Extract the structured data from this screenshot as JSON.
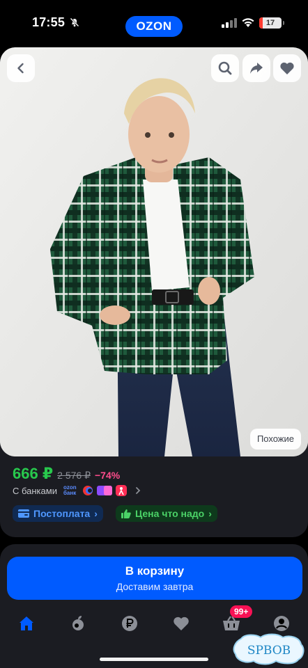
{
  "status_bar": {
    "time": "17:55",
    "brand": "OZON",
    "battery_level": "17",
    "battery_fraction": 0.17
  },
  "product": {
    "similar_label": "Похожие",
    "price": "666 ₽",
    "old_price": "2 576 ₽",
    "discount": "−74%",
    "banks_label": "С банками",
    "bank_ozon_line1": "ozon",
    "bank_ozon_line2": "банк",
    "postpay_label": "Постоплата",
    "fair_price_label": "Цена что надо"
  },
  "action": {
    "cart_title": "В корзину",
    "cart_subtitle": "Доставим завтра"
  },
  "tabbar": {
    "cart_badge": "99+",
    "items": [
      "home-icon",
      "fresh-icon",
      "ruble-icon",
      "favorites-icon",
      "cart-icon",
      "profile-icon"
    ]
  },
  "watermark": "SPBOB",
  "colors": {
    "accent": "#005bff",
    "price": "#28c84d",
    "discount": "#ff4d8d",
    "badge": "#f91155"
  }
}
